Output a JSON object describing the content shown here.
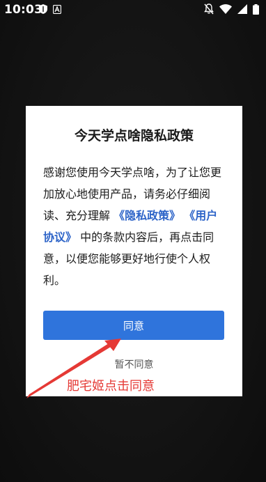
{
  "status_bar": {
    "time": "10:03",
    "left_icons": [
      "shield-icon",
      "a-badge-icon"
    ],
    "right_icons": [
      "notifications-off-icon",
      "wifi-icon",
      "signal-icon",
      "battery-icon"
    ]
  },
  "dialog": {
    "title": "今天学点啥隐私政策",
    "body_pre": "感谢您使用今天学点啥，为了让您更加放心地使用产品，请务必仔细阅读、充分理解",
    "privacy_link": "《隐私政策》",
    "user_agreement_link": "《用户协议》",
    "body_post": "中的条款内容后，再点击同意，以便您能够更好地行使个人权利。",
    "agree_label": "同意",
    "disagree_label": "暂不同意"
  },
  "annotation": {
    "text": "肥宅姬点击同意",
    "color": "#e53935"
  },
  "colors": {
    "accent": "#2f74dc",
    "link": "#2d64c8"
  }
}
